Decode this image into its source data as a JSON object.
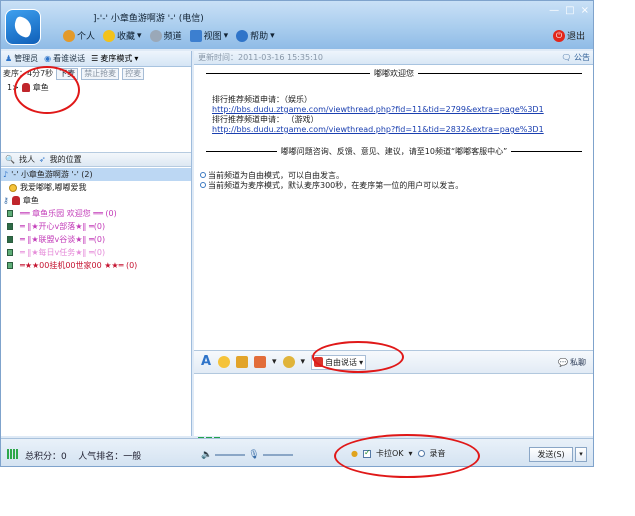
{
  "window": {
    "title": "]-'-' 小章鱼游啊游 '-' (电信)",
    "controls": [
      "—",
      "□",
      "×"
    ],
    "logout_label": "退出"
  },
  "menu": [
    {
      "label": "个人",
      "icon": "person-icon"
    },
    {
      "label": "收藏",
      "icon": "star-icon"
    },
    {
      "label": "频道",
      "icon": "channel-icon"
    },
    {
      "label": "视图",
      "icon": "view-icon"
    },
    {
      "label": "帮助",
      "icon": "help-icon"
    }
  ],
  "left_tabs": [
    {
      "label": "管理员"
    },
    {
      "label": "看谁说话"
    },
    {
      "label": "麦序模式"
    }
  ],
  "queue": {
    "time_label": "麦序：4分7秒",
    "buttons": [
      "下麦",
      "禁止抢麦",
      "控麦"
    ],
    "entry_index": "1>",
    "entry_name": "章鱼"
  },
  "search": {
    "find_label": "找人",
    "location_label": "我的位置"
  },
  "tree": [
    {
      "label": "'-' 小章鱼游啊游 '-' (2)",
      "type": "channel"
    },
    {
      "label": "我爱嘟嘟,嘟嘟爱我",
      "type": "user"
    },
    {
      "label": "章鱼",
      "type": "user"
    },
    {
      "label": "══ 章鱼乐园 欢迎您 ══ (0)",
      "type": "room"
    },
    {
      "label": "═ ‖★开心v部落★‖ ═(0)",
      "type": "room"
    },
    {
      "label": "═ ‖★联盟v谷谈★‖ ═(0)",
      "type": "room"
    },
    {
      "label": "═ ‖★每日v任务★‖ ═(0)",
      "type": "room"
    },
    {
      "label": "═★★00挂机00世家00 ★★═ (0)",
      "type": "room"
    }
  ],
  "topic_bar": {
    "updated": "更新时间：2011-03-16 15:35:10",
    "notice_label": "公告"
  },
  "notice": {
    "title": "嘟嘟欢迎您",
    "line1": "排行推荐频道申请：（娱乐）",
    "link1": "http://bbs.dudu.ztgame.com/viewthread.php?fid=11&tid=2799&extra=page%3D1",
    "line2": "排行推荐频道申请：  （游戏）",
    "link2": "http://bbs.dudu.ztgame.com/viewthread.php?fid=11&tid=2832&extra=page%3D1",
    "footer": "嘟嘟问题咨询、反馈、意见、建议，请至10频道“嘟嘟客服中心”"
  },
  "system_messages": [
    "当前频道为自由模式，可以自由发言。",
    "当前频道为麦序模式，默认麦序300秒，在麦序第一位的用户可以发言。"
  ],
  "input_toolbar": {
    "mode_label": "自由说话",
    "private_label": "私聊"
  },
  "status": {
    "score_label": "总积分：0",
    "rank_label": "人气排名：一般",
    "karaoke_label": "卡拉OK",
    "record_label": "录音",
    "send_label": "发送(S)"
  }
}
